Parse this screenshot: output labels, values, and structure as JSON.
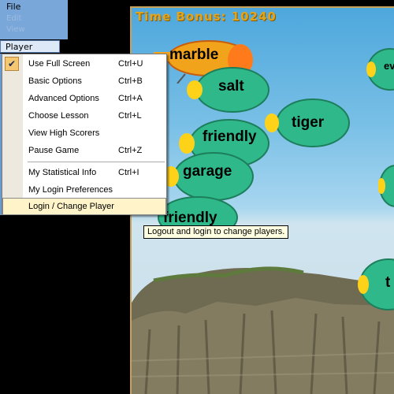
{
  "menubar": {
    "file_label": "File",
    "ghost_items": [
      "Edit",
      "View"
    ],
    "player_menu_label": "Player menu"
  },
  "game": {
    "time_bonus_label": "Time Bonus:",
    "time_bonus_value": "10240",
    "words": [
      "marble",
      "salt",
      "tiger",
      "friendly",
      "garage",
      "friendly",
      "ev",
      "t"
    ]
  },
  "popup_menu": {
    "items": [
      {
        "label": "Use Full Screen",
        "shortcut": "Ctrl+U",
        "checked": true
      },
      {
        "label": "Basic Options",
        "shortcut": "Ctrl+B"
      },
      {
        "label": "Advanced Options",
        "shortcut": "Ctrl+A"
      },
      {
        "label": "Choose Lesson",
        "shortcut": "Ctrl+L"
      },
      {
        "label": "View High Scorers",
        "shortcut": ""
      },
      {
        "label": "Pause Game",
        "shortcut": "Ctrl+Z"
      },
      {
        "label": "My Statistical Info",
        "shortcut": "Ctrl+I"
      },
      {
        "label": "My Login Preferences",
        "shortcut": ""
      },
      {
        "label": "Login / Change Player",
        "shortcut": "",
        "highlighted": true
      }
    ]
  },
  "tooltip": {
    "text": "Logout and login to change players."
  },
  "colors": {
    "menubar": "#7aa7d9",
    "highlight": "#fff3c9",
    "check_bg": "#f4c772",
    "time_bonus": "#e0a41e",
    "bug_body": "#2fb98a",
    "tooltip_bg": "#ffffe1"
  }
}
